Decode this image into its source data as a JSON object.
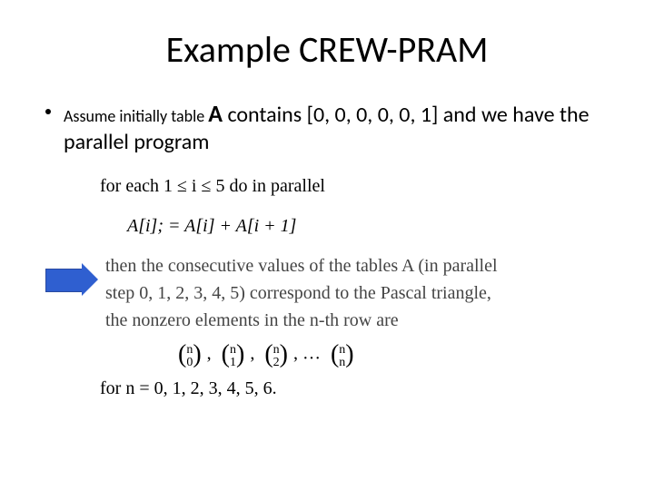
{
  "title": "Example  CREW-PRAM",
  "bullet": {
    "prefix_small": "Assume initially table ",
    "big_a": "A",
    "rest": " contains [0, 0, 0, 0, 0, 1] and we have the parallel program"
  },
  "line1": "for each 1 ≤ i ≤ 5 do in parallel",
  "line2": "A[i]; = A[i] + A[i + 1]",
  "then1": "then the consecutive values of the tables A (in parallel",
  "then2": "step 0, 1, 2, 3, 4, 5) correspond to the Pascal triangle,",
  "then3": "the nonzero elements in the n-th row are",
  "binom": {
    "top": "n",
    "b0": "0",
    "b1": "1",
    "b2": "2",
    "bn": "n",
    "dots": "…",
    "comma": ","
  },
  "forn": "for n  =   0, 1, 2, 3, 4, 5, 6."
}
